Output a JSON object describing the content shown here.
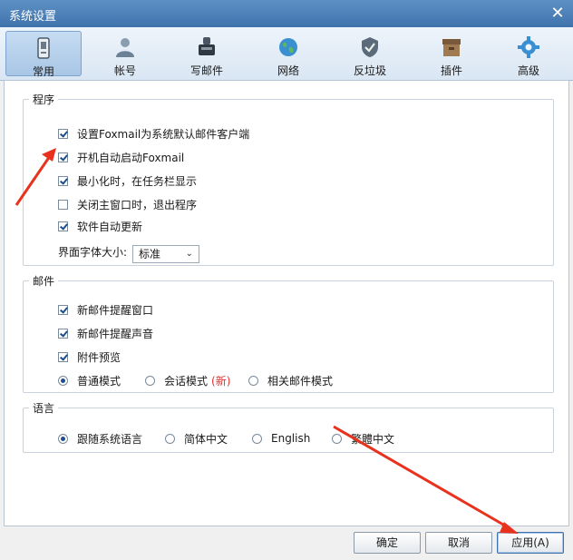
{
  "window": {
    "title": "系统设置",
    "close_glyph": "✕"
  },
  "toolbar": {
    "items": [
      {
        "label": "常用",
        "icon": "general-icon"
      },
      {
        "label": "帐号",
        "icon": "account-icon"
      },
      {
        "label": "写邮件",
        "icon": "compose-icon"
      },
      {
        "label": "网络",
        "icon": "network-icon"
      },
      {
        "label": "反垃圾",
        "icon": "antispam-icon"
      },
      {
        "label": "插件",
        "icon": "plugin-icon"
      },
      {
        "label": "高级",
        "icon": "advanced-icon"
      }
    ],
    "active_index": 0
  },
  "program": {
    "legend": "程序",
    "options": [
      {
        "label": "设置Foxmail为系统默认邮件客户端",
        "checked": true
      },
      {
        "label": "开机自动启动Foxmail",
        "checked": true
      },
      {
        "label": "最小化时，在任务栏显示",
        "checked": true
      },
      {
        "label": "关闭主窗口时，退出程序",
        "checked": false
      },
      {
        "label": "软件自动更新",
        "checked": true
      }
    ],
    "font_size_label": "界面字体大小:",
    "font_size_value": "标准"
  },
  "mail": {
    "legend": "邮件",
    "options": [
      {
        "label": "新邮件提醒窗口",
        "checked": true
      },
      {
        "label": "新邮件提醒声音",
        "checked": true
      },
      {
        "label": "附件预览",
        "checked": true
      }
    ],
    "modes": [
      {
        "label": "普通模式",
        "selected": true
      },
      {
        "label": "会话模式",
        "selected": false,
        "tag": "(新)"
      },
      {
        "label": "相关邮件模式",
        "selected": false
      }
    ]
  },
  "language": {
    "legend": "语言",
    "options": [
      {
        "label": "跟随系统语言",
        "selected": true
      },
      {
        "label": "简体中文",
        "selected": false
      },
      {
        "label": "English",
        "selected": false
      },
      {
        "label": "繁體中文",
        "selected": false
      }
    ]
  },
  "footer": {
    "ok": "确定",
    "cancel": "取消",
    "apply": "应用(A)"
  },
  "colors": {
    "annotation_arrow": "#e8321e",
    "accent": "#3f73ac"
  }
}
